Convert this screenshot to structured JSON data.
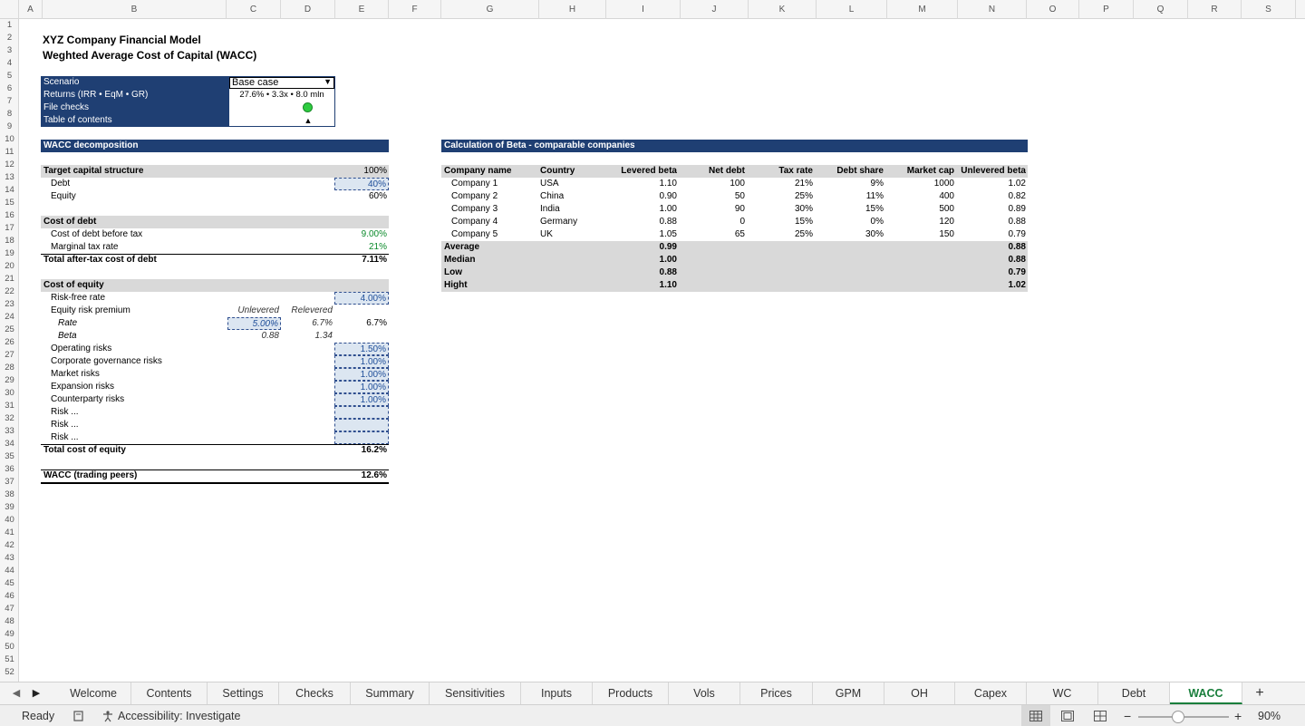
{
  "columns": [
    "A",
    "B",
    "C",
    "D",
    "E",
    "F",
    "G",
    "H",
    "I",
    "J",
    "K",
    "L",
    "M",
    "N",
    "O",
    "P",
    "Q",
    "R",
    "S"
  ],
  "rows": [
    "1",
    "2",
    "3",
    "4",
    "5",
    "6",
    "7",
    "8",
    "9",
    "10",
    "11",
    "12",
    "13",
    "14",
    "15",
    "16",
    "17",
    "18",
    "19",
    "20",
    "21",
    "22",
    "23",
    "24",
    "25",
    "26",
    "27",
    "28",
    "29",
    "30",
    "31",
    "32",
    "33",
    "34",
    "35",
    "36",
    "37",
    "38",
    "39",
    "40",
    "41",
    "42",
    "43",
    "44",
    "45",
    "46",
    "47",
    "48",
    "49",
    "50",
    "51",
    "52"
  ],
  "header": {
    "title": "XYZ Company Financial Model",
    "subtitle": "Weghted Average Cost of Capital (WACC)"
  },
  "info": {
    "scenario_label": "Scenario",
    "scenario_value": "Base case",
    "returns_label": "Returns (IRR • EqM • GR)",
    "returns_value": "27.6% • 3.3x • 8.0 mln",
    "checks_label": "File checks",
    "toc_label": "Table of contents",
    "toc_symbol": "▲",
    "check_color": "#2ecc40"
  },
  "wacc": {
    "section_title": "WACC decomposition",
    "target_label": "Target capital structure",
    "target_value": "100%",
    "debt_label": "Debt",
    "debt_value": "40%",
    "equity_label": "Equity",
    "equity_value": "60%",
    "cod_title": "Cost of debt",
    "cod_before_label": "Cost of debt before tax",
    "cod_before_value": "9.00%",
    "tax_label": "Marginal tax rate",
    "tax_value": "21%",
    "cod_total_label": "Total after-tax cost of debt",
    "cod_total_value": "7.11%",
    "coe_title": "Cost of equity",
    "rf_label": "Risk-free rate",
    "rf_value": "4.00%",
    "erp_label": "Equity risk premium",
    "unlevered_label": "Unlevered",
    "relevered_label": "Relevered",
    "rate_label": "Rate",
    "rate_unlevered": "5.00%",
    "rate_relevered": "6.7%",
    "rate_total": "6.7%",
    "beta_label": "Beta",
    "beta_unlevered": "0.88",
    "beta_relevered": "1.34",
    "risks": [
      {
        "label": "Operating risks",
        "value": "1.50%"
      },
      {
        "label": "Corporate governance risks",
        "value": "1.00%"
      },
      {
        "label": "Market risks",
        "value": "1.00%"
      },
      {
        "label": "Expansion risks",
        "value": "1.00%"
      },
      {
        "label": "Counterparty risks",
        "value": "1.00%"
      },
      {
        "label": "Risk ...",
        "value": ""
      },
      {
        "label": "Risk ...",
        "value": ""
      },
      {
        "label": "Risk ...",
        "value": ""
      }
    ],
    "coe_total_label": "Total cost of equity",
    "coe_total_value": "16.2%",
    "wacc_label": "WACC (trading peers)",
    "wacc_value": "12.6%"
  },
  "beta": {
    "section_title": "Calculation of Beta - comparable companies",
    "headers": [
      "Company name",
      "Country",
      "Levered beta",
      "Net debt",
      "Tax rate",
      "Debt share",
      "Market cap",
      "Unlevered beta"
    ],
    "rows": [
      [
        "Company 1",
        "USA",
        "1.10",
        "100",
        "21%",
        "9%",
        "1000",
        "1.02"
      ],
      [
        "Company 2",
        "China",
        "0.90",
        "50",
        "25%",
        "11%",
        "400",
        "0.82"
      ],
      [
        "Company 3",
        "India",
        "1.00",
        "90",
        "30%",
        "15%",
        "500",
        "0.89"
      ],
      [
        "Company 4",
        "Germany",
        "0.88",
        "0",
        "15%",
        "0%",
        "120",
        "0.88"
      ],
      [
        "Company 5",
        "UK",
        "1.05",
        "65",
        "25%",
        "30%",
        "150",
        "0.79"
      ]
    ],
    "stats": [
      {
        "label": "Average",
        "levered": "0.99",
        "unlevered": "0.88"
      },
      {
        "label": "Median",
        "levered": "1.00",
        "unlevered": "0.88"
      },
      {
        "label": "Low",
        "levered": "0.88",
        "unlevered": "0.79"
      },
      {
        "label": "Hight",
        "levered": "1.10",
        "unlevered": "1.02"
      }
    ]
  },
  "tabs": [
    "Welcome",
    "Contents",
    "Settings",
    "Checks",
    "Summary",
    "Sensitivities",
    "Inputs",
    "Products",
    "Vols",
    "Prices",
    "GPM",
    "OH",
    "Capex",
    "WC",
    "Debt",
    "WACC"
  ],
  "active_tab": "WACC",
  "add_sheet_symbol": "+",
  "status": {
    "ready": "Ready",
    "accessibility": "Accessibility: Investigate",
    "zoom": "90%",
    "zoom_level": 0.9
  },
  "colors": {
    "navy": "#1f3f73",
    "input_blue": "#1f4e99",
    "green": "#0a8a2a",
    "accent": "#1a7f3c"
  }
}
